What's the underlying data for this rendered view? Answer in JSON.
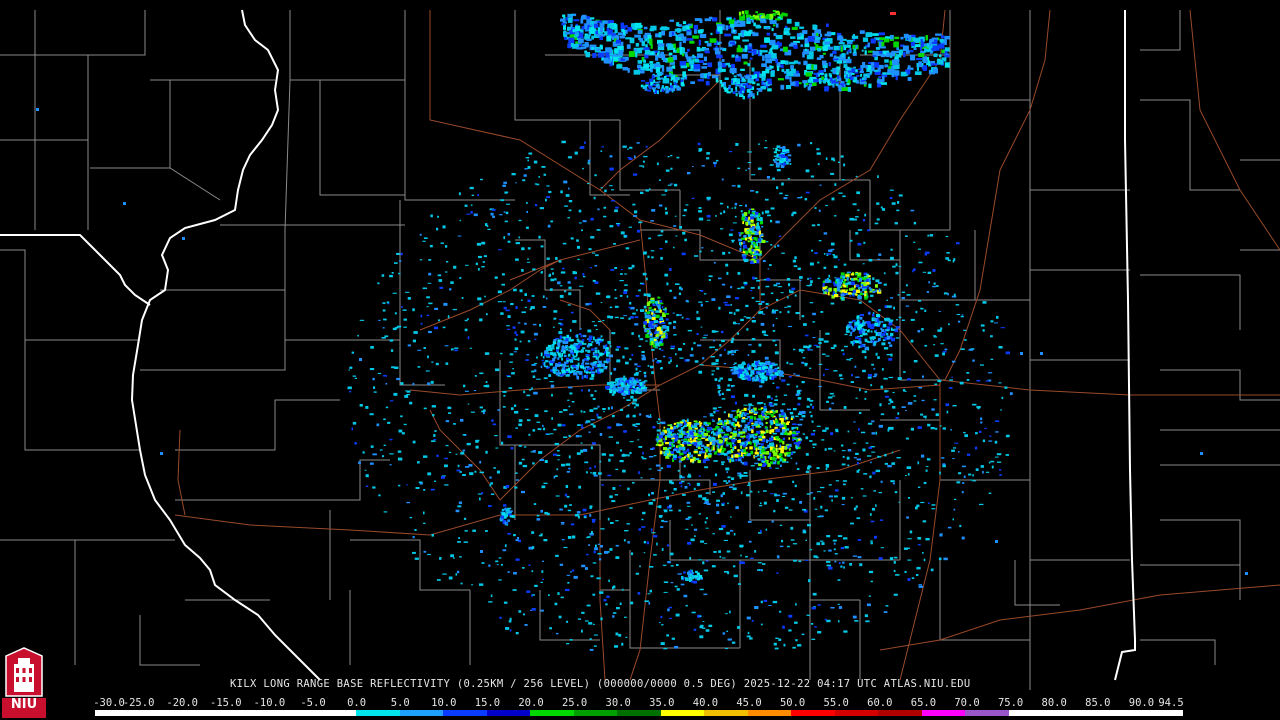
{
  "product": {
    "station": "KILX",
    "description": "LONG RANGE BASE REFLECTIVITY",
    "params": "(0.25KM / 256 LEVEL)",
    "volume": "(000000/0000 0.5 DEG)",
    "date": "2025-12-22",
    "time": "04:17 UTC",
    "site": "ATLAS.NIU.EDU",
    "caption": "KILX LONG RANGE BASE REFLECTIVITY (0.25KM / 256 LEVEL) (000000/0000 0.5 DEG) 2025-12-22 04:17 UTC  ATLAS.NIU.EDU"
  },
  "logo": {
    "text": "NIU",
    "icon": "university-tower-icon",
    "background_color": "#c8102e"
  },
  "color_scale": {
    "labels": [
      "-30.0",
      "-25.0",
      "-20.0",
      "-15.0",
      "-10.0",
      "-5.0",
      "0.0",
      "5.0",
      "10.0",
      "15.0",
      "20.0",
      "25.0",
      "30.0",
      "35.0",
      "40.0",
      "45.0",
      "50.0",
      "55.0",
      "60.0",
      "65.0",
      "70.0",
      "75.0",
      "80.0",
      "85.0",
      "90.0",
      "94.5"
    ],
    "colors": [
      "#ffffff",
      "#ffffff",
      "#ffffff",
      "#ffffff",
      "#ffffff",
      "#ffffff",
      "#00e5ee",
      "#1ea0ff",
      "#0a3cff",
      "#0000c8",
      "#00d800",
      "#00a000",
      "#007000",
      "#ffff00",
      "#f0c000",
      "#ff8c00",
      "#ff0000",
      "#d40000",
      "#b00000",
      "#ff00ff",
      "#9a55c9",
      "#ffffff",
      "#ffffff",
      "#ffffff",
      "#ffffff"
    ]
  },
  "map_colors": {
    "background": "#000000",
    "county_borders": "#8a8a8a",
    "state_borders": "#ffffff",
    "highways": "#9a4a2a"
  },
  "radar": {
    "site_label": "KILX"
  }
}
